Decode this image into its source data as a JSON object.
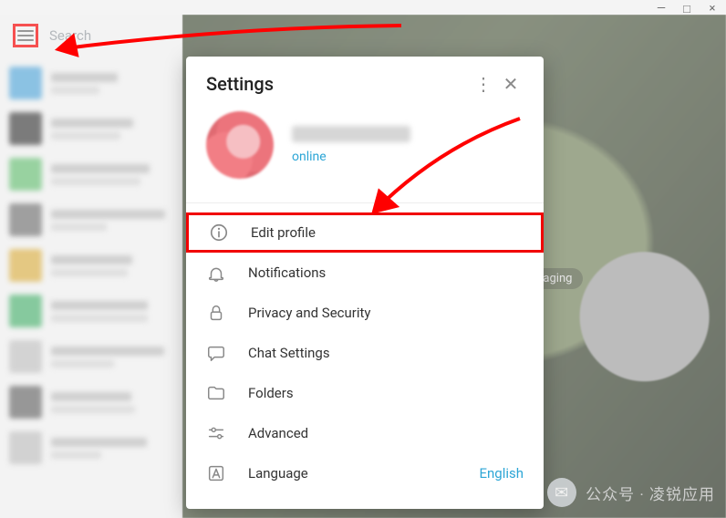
{
  "window": {
    "minimize": "—",
    "maximize": "□",
    "close": "×"
  },
  "search": {
    "placeholder": "Search"
  },
  "welcome_pill": "ssaging",
  "settings": {
    "title": "Settings",
    "status": "online",
    "items": {
      "edit": {
        "label": "Edit profile"
      },
      "notif": {
        "label": "Notifications"
      },
      "privacy": {
        "label": "Privacy and Security"
      },
      "chat": {
        "label": "Chat Settings"
      },
      "folders": {
        "label": "Folders"
      },
      "advanced": {
        "label": "Advanced"
      },
      "language": {
        "label": "Language",
        "value": "English"
      }
    }
  },
  "chatlist_avatars": [
    "#4aa7e0",
    "#2f2f2f",
    "#61c36f",
    "#6d6d6d",
    "#e2b23b",
    "#42b56a",
    "#c5c5c5",
    "#5f5f5f",
    "#c3c3c3"
  ],
  "watermark": "公众号 · 凌锐应用"
}
